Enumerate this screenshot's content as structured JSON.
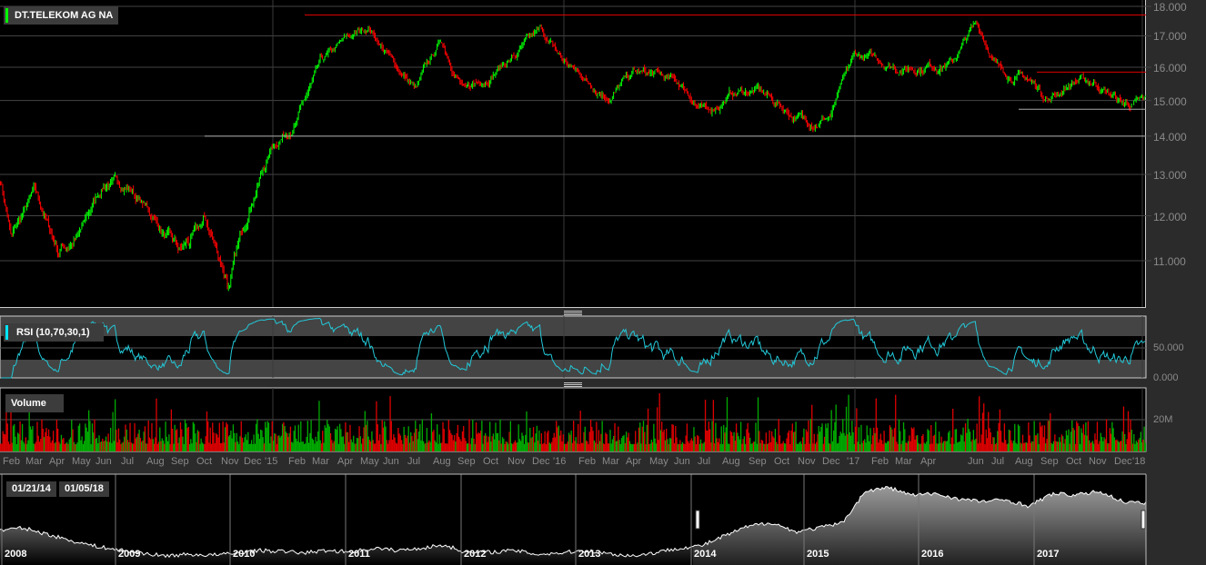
{
  "instrument": {
    "name": "DT.TELEKOM AG NA",
    "accent": "#00ff00"
  },
  "rsi": {
    "label": "RSI (10,70,30,1)",
    "accent": "#00e5ff",
    "axis": [
      "50.000",
      "0.000"
    ],
    "upper": 70,
    "lower": 30
  },
  "volume": {
    "label": "Volume",
    "axis": [
      "20M"
    ]
  },
  "range": {
    "from": "01/21/14",
    "to": "01/05/18"
  },
  "colors": {
    "up": "#00ff00",
    "down": "#ff0000",
    "rsi_line": "#22c8d8"
  },
  "chart_data": {
    "type": "candlestick",
    "title": "DT.TELEKOM AG NA",
    "y_ticks": [
      "18.000",
      "17.000",
      "16.000",
      "15.000",
      "14.000",
      "13.000",
      "12.000",
      "11.000"
    ],
    "y_tick_values": [
      18,
      17,
      16,
      15,
      14,
      13,
      12,
      11
    ],
    "ylim": [
      10,
      18.2
    ],
    "x_labels": [
      "Feb",
      "Mar",
      "Apr",
      "May",
      "Jun",
      "Jul",
      "Aug",
      "Sep",
      "Oct",
      "Nov",
      "Dec",
      "'15",
      "Feb",
      "Mar",
      "Apr",
      "May",
      "Jun",
      "Jul",
      "Aug",
      "Sep",
      "Oct",
      "Nov",
      "Dec",
      "'16",
      "Feb",
      "Mar",
      "Apr",
      "May",
      "Jun",
      "Jul",
      "Aug",
      "Sep",
      "Oct",
      "Nov",
      "Dec",
      "'17",
      "Feb",
      "Mar",
      "Apr",
      "Jun",
      "Jul",
      "Aug",
      "Sep",
      "Oct",
      "Nov",
      "Dec",
      "'18"
    ],
    "monthly_close_approx": [
      12.9,
      11.5,
      12.5,
      11.2,
      11.6,
      12.8,
      12.7,
      11.9,
      11.1,
      11.8,
      10.5,
      12.5,
      13.8,
      14.5,
      16.0,
      16.8,
      17.3,
      16.2,
      15.3,
      16.8,
      15.2,
      15.9,
      16.4,
      17.1,
      16.2,
      15.6,
      15.2,
      15.8,
      15.7,
      15.4,
      14.6,
      15.2,
      15.3,
      14.8,
      14.4,
      14.6,
      16.3,
      16.2,
      16.0,
      16.1,
      16.2,
      17.4,
      15.9,
      15.7,
      15.1,
      15.6,
      15.5,
      14.9,
      14.9
    ],
    "trendlines": [
      17.7,
      15.85,
      14.75,
      14.0
    ],
    "navigator": {
      "years": [
        "2008",
        "2009",
        "2010",
        "2011",
        "2012",
        "2013",
        "2014",
        "2015",
        "2016",
        "2017"
      ],
      "quarterly_close_approx": [
        11.5,
        11.8,
        11.0,
        10.2,
        9.5,
        9.0,
        8.6,
        8.2,
        8.4,
        8.3,
        8.5,
        8.9,
        8.8,
        8.6,
        8.9,
        8.7,
        9.2,
        8.9,
        9.2,
        9.6,
        8.6,
        8.7,
        8.9,
        8.4,
        8.6,
        8.9,
        8.5,
        8.2,
        8.6,
        9.2,
        9.5,
        10.8,
        12.0,
        12.5,
        11.3,
        11.8,
        12.4,
        16.5,
        17.0,
        16.0,
        16.2,
        15.5,
        15.2,
        15.4,
        14.6,
        16.2,
        16.0,
        16.5,
        15.2,
        14.9
      ]
    }
  }
}
